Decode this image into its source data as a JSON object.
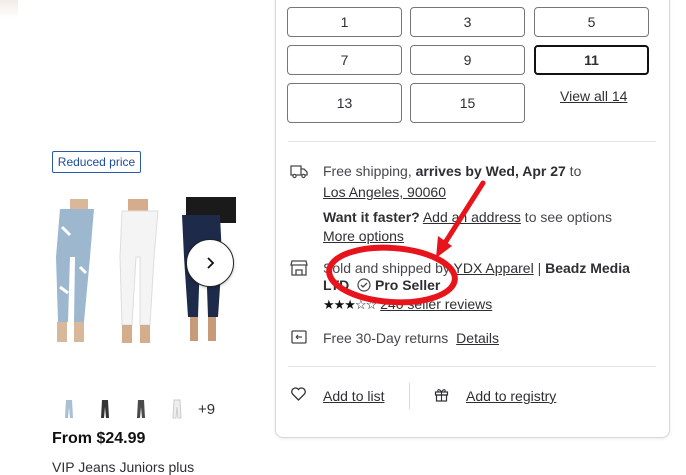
{
  "badge": {
    "reduced": "Reduced price"
  },
  "product": {
    "more_colors": "+9",
    "price": "From $24.99",
    "title": "VIP Jeans Juniors plus"
  },
  "sizes": {
    "row1": [
      "1",
      "3",
      "5"
    ],
    "row2": [
      "7",
      "9",
      "11"
    ],
    "row3": [
      "13",
      "15"
    ],
    "selected": "11",
    "view_all": "View all 14"
  },
  "shipping": {
    "prefix": "Free shipping, ",
    "arrives": "arrives by Wed, Apr 27",
    "to": " to",
    "location": "Los Angeles, 90060",
    "faster_q": "Want it faster?",
    "add_address": "Add an address",
    "see_options": " to see options",
    "more_options": "More options"
  },
  "seller": {
    "sold_by": "Sold and shipped by ",
    "name1": "YDX Apparel",
    "sep": " | ",
    "name2": "Beadz Media",
    "name2_cont": "LTD",
    "pro": "Pro Seller",
    "reviews": "240 seller reviews",
    "rating_stars": 3.5
  },
  "returns": {
    "label": "Free 30-Day returns",
    "details": "Details"
  },
  "actions": {
    "add_list": "Add to list",
    "add_registry": "Add to registry"
  },
  "colors": {
    "annotation": "#e8141c",
    "badge_blue": "#1c4c9c"
  }
}
